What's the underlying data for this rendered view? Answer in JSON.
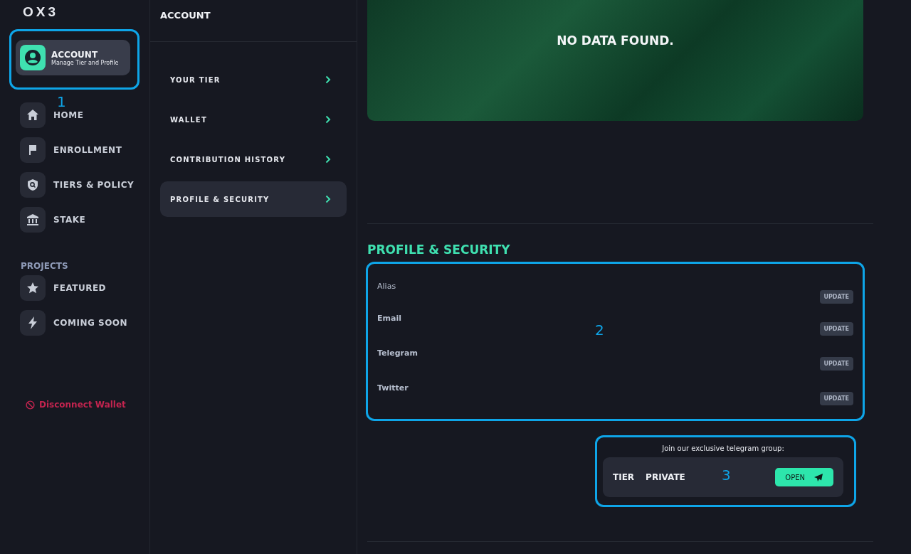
{
  "logo": {
    "text": "OX3"
  },
  "sidebar": {
    "account": {
      "title": "ACCOUNT",
      "subtitle": "Manage Tier and Profile",
      "selected": true
    },
    "items": [
      {
        "label": "HOME",
        "selected": false
      },
      {
        "label": "ENROLLMENT",
        "selected": false
      },
      {
        "label": "TIERS & POLICY",
        "selected": false
      },
      {
        "label": "STAKE",
        "selected": false
      }
    ],
    "projects_heading": "PROJECTS",
    "projects": [
      {
        "label": "FEATURED",
        "selected": false
      },
      {
        "label": "COMING SOON",
        "selected": false
      }
    ],
    "disconnect": "Disconnect Wallet"
  },
  "account_menu": {
    "title": "ACCOUNT",
    "items": [
      {
        "label": "YOUR TIER",
        "selected": false
      },
      {
        "label": "WALLET",
        "selected": false
      },
      {
        "label": "CONTRIBUTION HISTORY",
        "selected": false
      },
      {
        "label": "PROFILE & SECURITY",
        "selected": true
      }
    ]
  },
  "banner": {
    "message": "NO DATA FOUND."
  },
  "profile": {
    "heading": "PROFILE & SECURITY",
    "fields": [
      {
        "label": "Alias",
        "button": "UPDATE"
      },
      {
        "label": "Email",
        "button": "UPDATE"
      },
      {
        "label": "Telegram",
        "button": "UPDATE"
      },
      {
        "label": "Twitter",
        "button": "UPDATE"
      }
    ]
  },
  "telegram": {
    "caption": "Join our exclusive telegram group:",
    "tier_label": "TIER",
    "tier_value": "PRIVATE",
    "button": "OPEN"
  },
  "annotations": [
    {
      "label": "1"
    },
    {
      "label": "2"
    },
    {
      "label": "3"
    }
  ]
}
